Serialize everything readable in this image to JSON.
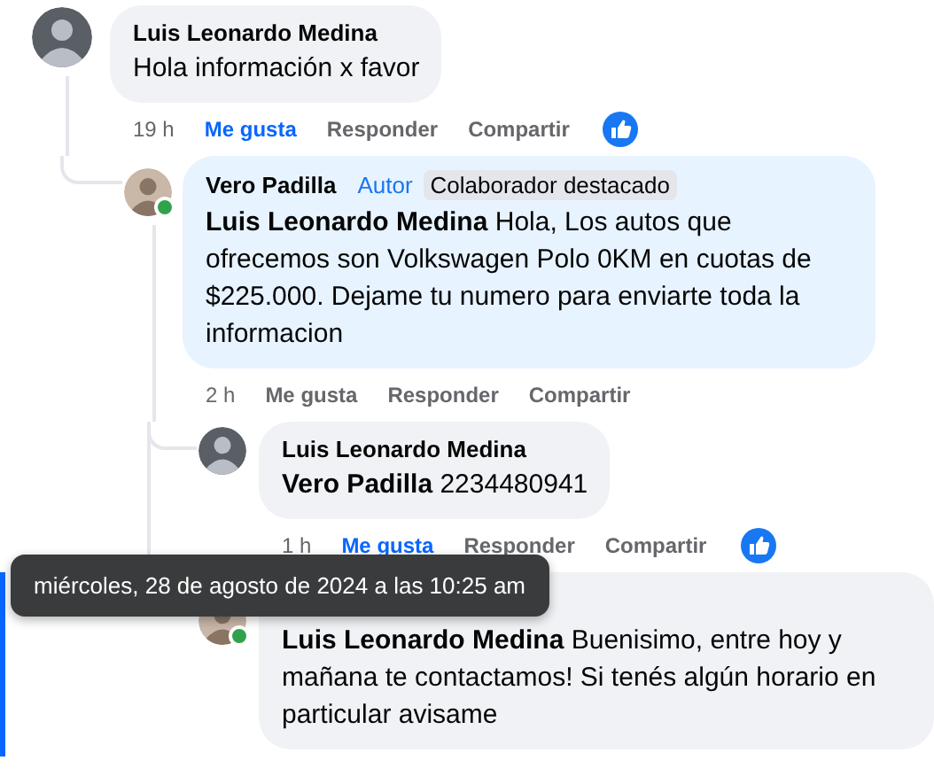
{
  "comments": [
    {
      "author": "Luis Leonardo Medina",
      "online": false,
      "text": "Hola información x favor",
      "time": "19 h",
      "liked": true,
      "actions": [
        "Me gusta",
        "Responder",
        "Compartir"
      ],
      "highlighted": false,
      "children": [
        {
          "author": "Vero Padilla",
          "online": true,
          "badges": [
            {
              "kind": "role",
              "label": "Autor"
            },
            {
              "kind": "chip",
              "label": "Colaborador destacado"
            }
          ],
          "text": "**Luis Leonardo Medina** Hola, Los autos que ofrecemos son Volkswagen Polo 0KM en cuotas de $225.000. Dejame tu numero para enviarte toda la informacion",
          "time": "2 h",
          "liked": false,
          "actions": [
            "Me gusta",
            "Responder",
            "Compartir"
          ],
          "highlighted": false,
          "children": [
            {
              "author": "Luis Leonardo Medina",
              "online": false,
              "text": "**Vero Padilla** 2234480941",
              "time": "1 h",
              "liked": true,
              "actions": [
                "Me gusta",
                "Responder",
                "Compartir"
              ],
              "highlighted": false
            },
            {
              "online": true,
              "text": "**Luis Leonardo Medina** Buenisimo, entre hoy y mañana te contactamos! Si tenés algún horario en particular avisame",
              "highlighted": true,
              "tooltip": "miércoles, 28 de agosto de 2024 a las 10:25 am"
            }
          ]
        }
      ]
    }
  ]
}
